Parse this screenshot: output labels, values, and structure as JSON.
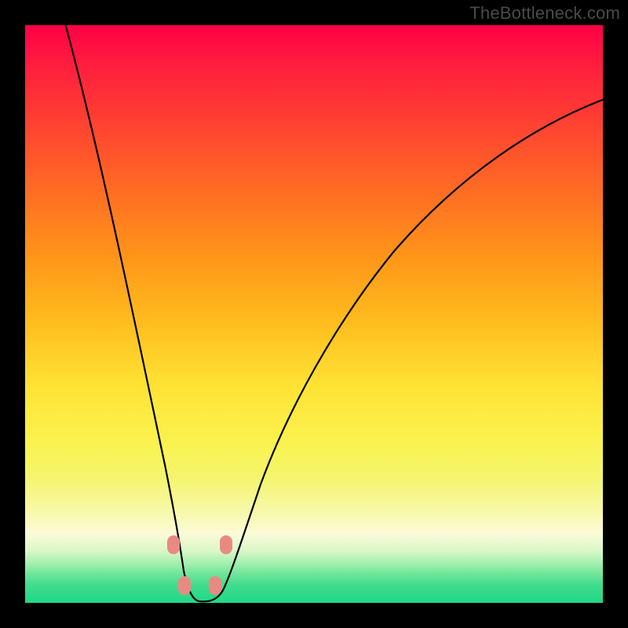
{
  "watermark": "TheBottleneck.com",
  "chart_data": {
    "type": "line",
    "title": "",
    "xlabel": "",
    "ylabel": "",
    "xlim": [
      0,
      100
    ],
    "ylim": [
      0,
      100
    ],
    "grid": false,
    "legend": false,
    "background_gradient": {
      "stops": [
        {
          "pos": 0.0,
          "color": "#ff0046"
        },
        {
          "pos": 0.15,
          "color": "#ff3a34"
        },
        {
          "pos": 0.4,
          "color": "#ff951a"
        },
        {
          "pos": 0.63,
          "color": "#ffe436"
        },
        {
          "pos": 0.84,
          "color": "#f7f8a8"
        },
        {
          "pos": 0.93,
          "color": "#a8f0b0"
        },
        {
          "pos": 1.0,
          "color": "#1fd886"
        }
      ]
    },
    "series": [
      {
        "name": "bottleneck-curve-left",
        "x": [
          7,
          10,
          13,
          16,
          19,
          22,
          24,
          25.5,
          27,
          28,
          29,
          31,
          33
        ],
        "y": [
          100,
          88,
          76,
          63,
          50,
          36,
          24,
          15,
          9,
          5,
          2,
          0,
          0
        ]
      },
      {
        "name": "bottleneck-curve-right",
        "x": [
          33,
          35,
          37,
          40,
          45,
          52,
          60,
          70,
          80,
          90,
          100
        ],
        "y": [
          0,
          2,
          6,
          12,
          22,
          34,
          46,
          58,
          68,
          76,
          82
        ]
      }
    ],
    "markers": [
      {
        "x": 25.5,
        "y": 10,
        "color": "#e98a82"
      },
      {
        "x": 34.5,
        "y": 10,
        "color": "#e98a82"
      },
      {
        "x": 27.5,
        "y": 3,
        "color": "#e98a82"
      },
      {
        "x": 33.0,
        "y": 3,
        "color": "#e98a82"
      }
    ]
  }
}
